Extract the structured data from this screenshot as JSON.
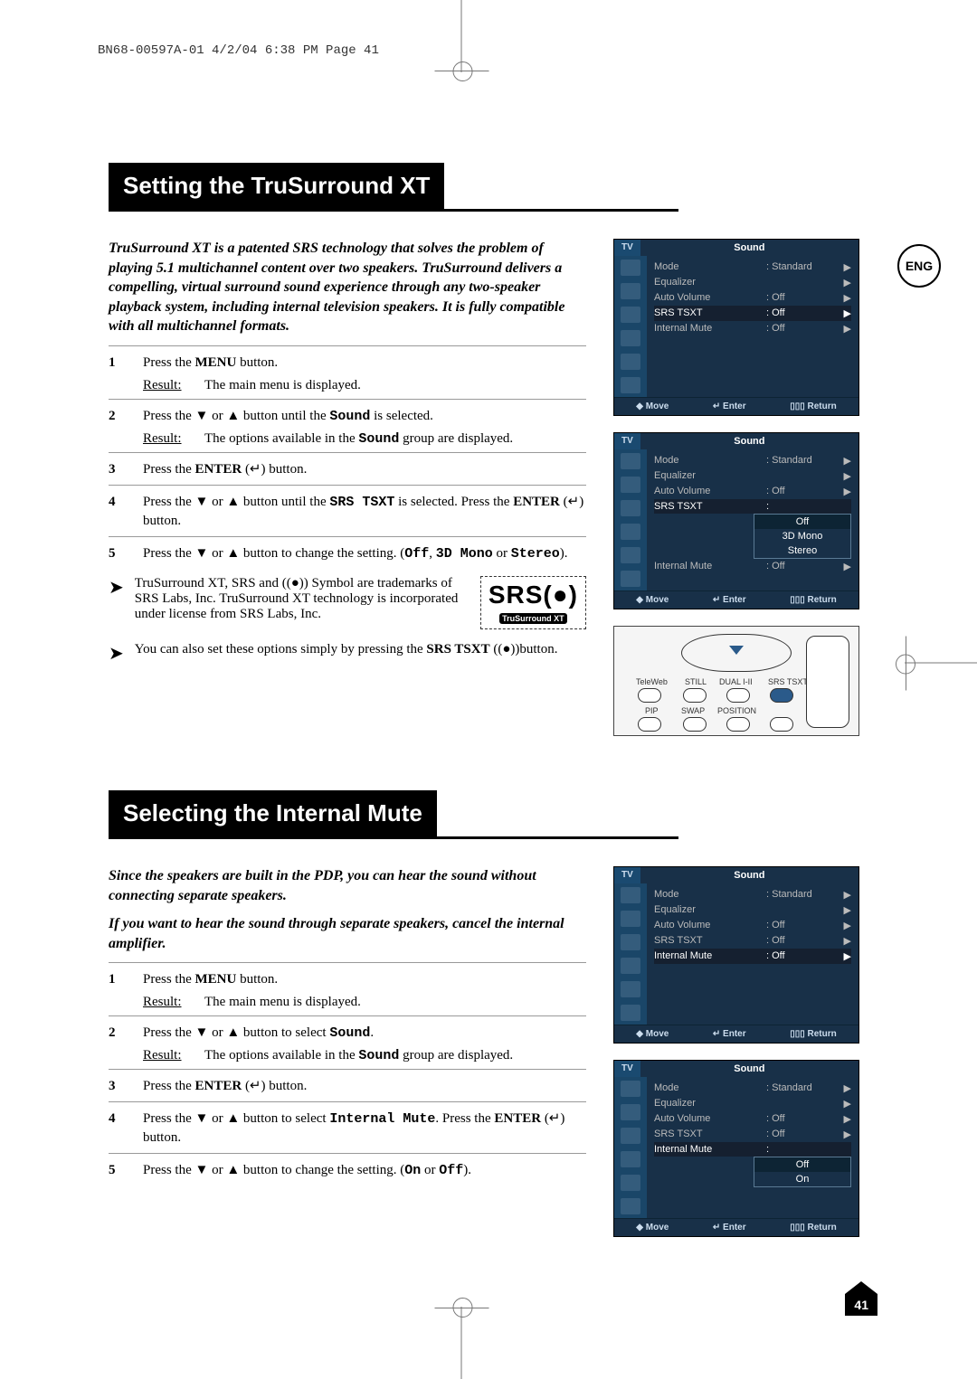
{
  "header": "BN68-00597A-01  4/2/04  6:38 PM  Page 41",
  "lang": "ENG",
  "page_num": "41",
  "s1": {
    "title": "Setting the TruSurround XT",
    "intro": "TruSurround XT is a patented SRS technology that solves the problem of playing 5.1 multichannel content over two speakers. TruSurround delivers a compelling, virtual surround sound experience through any two-speaker playback system, including internal television speakers. It is fully compatible with all multichannel formats.",
    "steps": [
      {
        "n": "1",
        "body": "Press the <b>MENU</b> button.",
        "result": "The main menu is displayed."
      },
      {
        "n": "2",
        "body": "Press the ▼ or ▲ button until the <b class='mono'>Sound</b> is selected.",
        "result": "The options available in the <b class='mono'>Sound</b> group are displayed."
      },
      {
        "n": "3",
        "body": "Press the <b>ENTER</b> (↵) button."
      },
      {
        "n": "4",
        "body": "Press the ▼ or ▲ button until the <b class='mono'>SRS TSXT</b> is selected. Press the <b>ENTER</b> (↵) button."
      },
      {
        "n": "5",
        "body": "Press the ▼ or ▲ button to change the setting. (<b class='mono'>Off</b>, <b class='mono'>3D Mono</b> or <b class='mono'>Stereo</b>)."
      }
    ],
    "note1": "TruSurround XT, SRS and ((●)) Symbol are trademarks of SRS Labs, Inc. TruSurround XT technology is incorporated under license from SRS Labs, Inc.",
    "note2": "You can also set these options simply by pressing the <b>SRS TSXT</b> ((●))button.",
    "srs": {
      "main": "SRS(●)",
      "sub": "TruSurround XT"
    }
  },
  "s2": {
    "title": "Selecting the Internal Mute",
    "intro": "Since the speakers are built in the PDP, you can hear the sound without connecting separate speakers.",
    "intro2": "If you want to hear the sound through separate speakers, cancel the internal amplifier.",
    "steps": [
      {
        "n": "1",
        "body": "Press the <b>MENU</b> button.",
        "result": "The main menu is displayed."
      },
      {
        "n": "2",
        "body": "Press the ▼ or ▲ button to select <b class='mono'>Sound</b>.",
        "result": "The options available in the <b class='mono'>Sound</b> group are displayed."
      },
      {
        "n": "3",
        "body": "Press the <b>ENTER</b> (↵) button."
      },
      {
        "n": "4",
        "body": "Press the ▼ or ▲ button to select <b class='mono'>Internal Mute</b>. Press the <b>ENTER</b> (↵) button."
      },
      {
        "n": "5",
        "body": "Press the ▼ or ▲ button to change the setting. (<b class='mono'>On</b> or <b class='mono'>Off</b>)."
      }
    ]
  },
  "osd": {
    "tv": "TV",
    "title": "Sound",
    "rows": [
      {
        "lab": "Mode",
        "val": ": Standard",
        "arr": "▶"
      },
      {
        "lab": "Equalizer",
        "val": "",
        "arr": "▶"
      },
      {
        "lab": "Auto Volume",
        "val": ": Off",
        "arr": "▶"
      },
      {
        "lab": "SRS TSXT",
        "val": ": Off",
        "arr": "▶"
      },
      {
        "lab": "Internal Mute",
        "val": ": Off",
        "arr": "▶"
      }
    ],
    "foot": {
      "move": "◆ Move",
      "enter": "↵ Enter",
      "ret": "▯▯▯ Return"
    },
    "srs_options": [
      "Off",
      "3D Mono",
      "Stereo"
    ],
    "mute_options": [
      "Off",
      "On"
    ]
  },
  "remote": {
    "labels": [
      "TeleWeb",
      "STILL",
      "DUAL I-II",
      "SRS TSXT",
      "PIP",
      "SWAP",
      "POSITION"
    ]
  }
}
